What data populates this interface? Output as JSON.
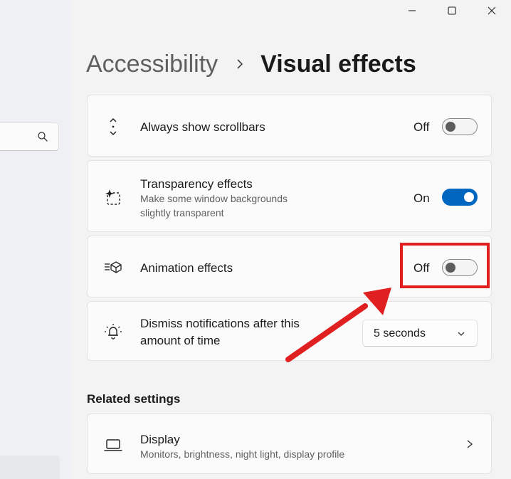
{
  "window": {
    "controls": [
      "minimize-icon",
      "maximize-icon",
      "close-icon"
    ]
  },
  "header": {
    "parent": "Accessibility",
    "separator_icon": "chevron-right-icon",
    "current": "Visual effects"
  },
  "search": {
    "icon": "search-icon"
  },
  "settings": {
    "scrollbars": {
      "icon": "scroll-arrows-icon",
      "title": "Always show scrollbars",
      "state": "Off",
      "enabled": false
    },
    "transparency": {
      "icon": "transparency-sparkle-icon",
      "title": "Transparency effects",
      "subtitle_line1": "Make some window backgrounds",
      "subtitle_line2": "slightly transparent",
      "state": "On",
      "enabled": true
    },
    "animation": {
      "icon": "animation-cube-icon",
      "title": "Animation effects",
      "state": "Off",
      "enabled": false
    },
    "notifications": {
      "icon": "bell-ringing-icon",
      "title_line1": "Dismiss notifications after this",
      "title_line2": "amount of time",
      "value": "5 seconds",
      "dropdown_icon": "chevron-down-icon"
    }
  },
  "related": {
    "heading": "Related settings",
    "display": {
      "icon": "laptop-icon",
      "title": "Display",
      "subtitle": "Monitors, brightness, night light, display profile",
      "chevron_icon": "chevron-right-icon"
    }
  },
  "annotation": {
    "color": "#e02020",
    "shapes": [
      "highlight-box",
      "pointer-arrow"
    ]
  },
  "colors": {
    "accent": "#0067c0",
    "background": "#f3f3f3",
    "card": "#fbfbfb"
  }
}
